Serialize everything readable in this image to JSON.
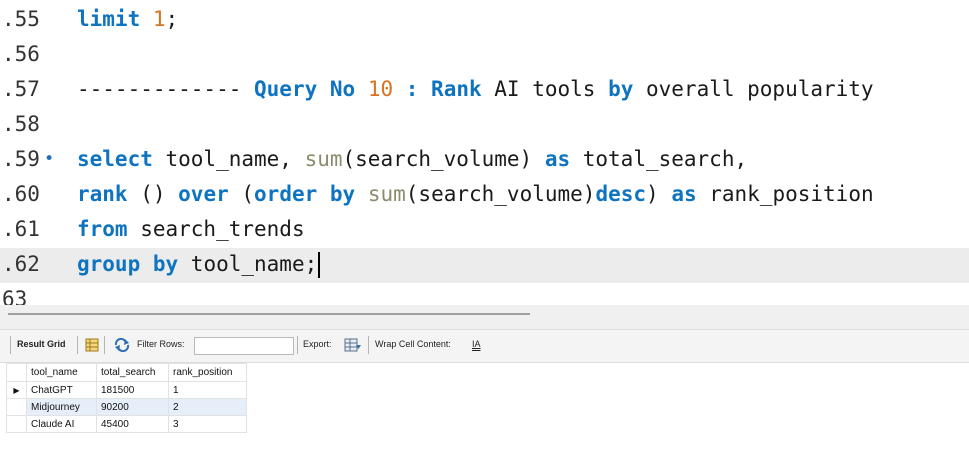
{
  "editor": {
    "lines": [
      {
        "num": ".55",
        "tokens": [
          {
            "t": "limit ",
            "c": "kw"
          },
          {
            "t": "1",
            "c": "num"
          },
          {
            "t": ";",
            "c": ""
          }
        ]
      },
      {
        "num": ".56",
        "tokens": []
      },
      {
        "num": ".57",
        "tokens": [
          {
            "t": "------------- ",
            "c": "dash"
          },
          {
            "t": "Query No ",
            "c": "kw"
          },
          {
            "t": "10",
            "c": "num"
          },
          {
            "t": " : ",
            "c": "kw"
          },
          {
            "t": "Rank",
            "c": "kw"
          },
          {
            "t": " AI tools ",
            "c": ""
          },
          {
            "t": "by",
            "c": "kw"
          },
          {
            "t": " overall popularity",
            "c": ""
          }
        ]
      },
      {
        "num": ".58",
        "tokens": []
      },
      {
        "num": ".59",
        "marker": "•",
        "tokens": [
          {
            "t": "select",
            "c": "kw"
          },
          {
            "t": " tool_name, ",
            "c": ""
          },
          {
            "t": "sum",
            "c": "fn"
          },
          {
            "t": "(search_volume) ",
            "c": ""
          },
          {
            "t": "as",
            "c": "kw"
          },
          {
            "t": " total_search,",
            "c": ""
          }
        ]
      },
      {
        "num": ".60",
        "tokens": [
          {
            "t": "rank",
            "c": "kw"
          },
          {
            "t": " () ",
            "c": ""
          },
          {
            "t": "over",
            "c": "kw"
          },
          {
            "t": " (",
            "c": ""
          },
          {
            "t": "order by",
            "c": "kw"
          },
          {
            "t": " ",
            "c": ""
          },
          {
            "t": "sum",
            "c": "fn"
          },
          {
            "t": "(search_volume)",
            "c": ""
          },
          {
            "t": "desc",
            "c": "kw"
          },
          {
            "t": ") ",
            "c": ""
          },
          {
            "t": "as",
            "c": "kw"
          },
          {
            "t": " rank_position",
            "c": ""
          }
        ]
      },
      {
        "num": ".61",
        "tokens": [
          {
            "t": "from",
            "c": "kw"
          },
          {
            "t": " search_trends",
            "c": ""
          }
        ]
      },
      {
        "num": ".62",
        "current": true,
        "tokens": [
          {
            "t": "group by",
            "c": "kw"
          },
          {
            "t": " tool_name;",
            "c": ""
          }
        ]
      },
      {
        "num": "63",
        "tokens": []
      }
    ]
  },
  "toolbar": {
    "result_grid": "Result Grid",
    "filter_rows": "Filter Rows:",
    "filter_value": "",
    "export": "Export:",
    "wrap_cell": "Wrap Cell Content:",
    "wrap_icon_text": "IA"
  },
  "grid": {
    "columns": [
      "tool_name",
      "total_search",
      "rank_position"
    ],
    "rows": [
      [
        "ChatGPT",
        "181500",
        "1"
      ],
      [
        "Midjourney",
        "90200",
        "2"
      ],
      [
        "Claude AI",
        "45400",
        "3"
      ]
    ],
    "selected_row_marker": "▶"
  }
}
